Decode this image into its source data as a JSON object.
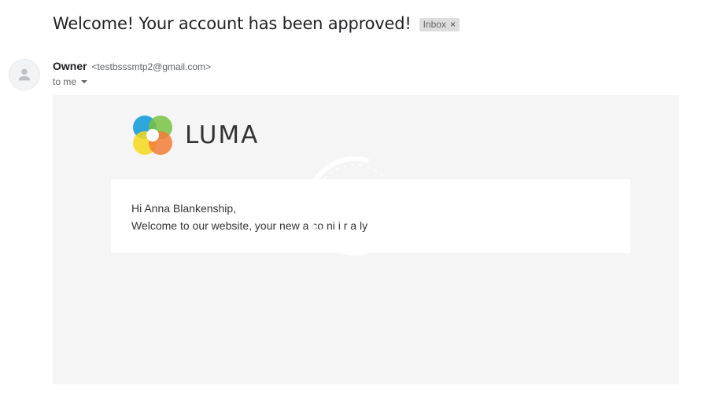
{
  "email": {
    "subject": "Welcome! Your account has been approved!",
    "label": "Inbox",
    "label_remove": "×",
    "sender_name": "Owner",
    "sender_email": "<testbsssmtp2@gmail.com>",
    "recipient": "to me",
    "avatar_icon": "person-icon"
  },
  "message": {
    "logo_text": "LUMA",
    "greeting": "Hi Anna Blankenship,",
    "welcome_text": "Welcome to our website, your new a co ni i r a ly"
  },
  "colors": {
    "logo_blue": "#1a9fd9",
    "logo_green": "#79c143",
    "logo_yellow": "#f5d81f",
    "logo_orange": "#f27c36",
    "body_background": "#f5f5f5"
  }
}
